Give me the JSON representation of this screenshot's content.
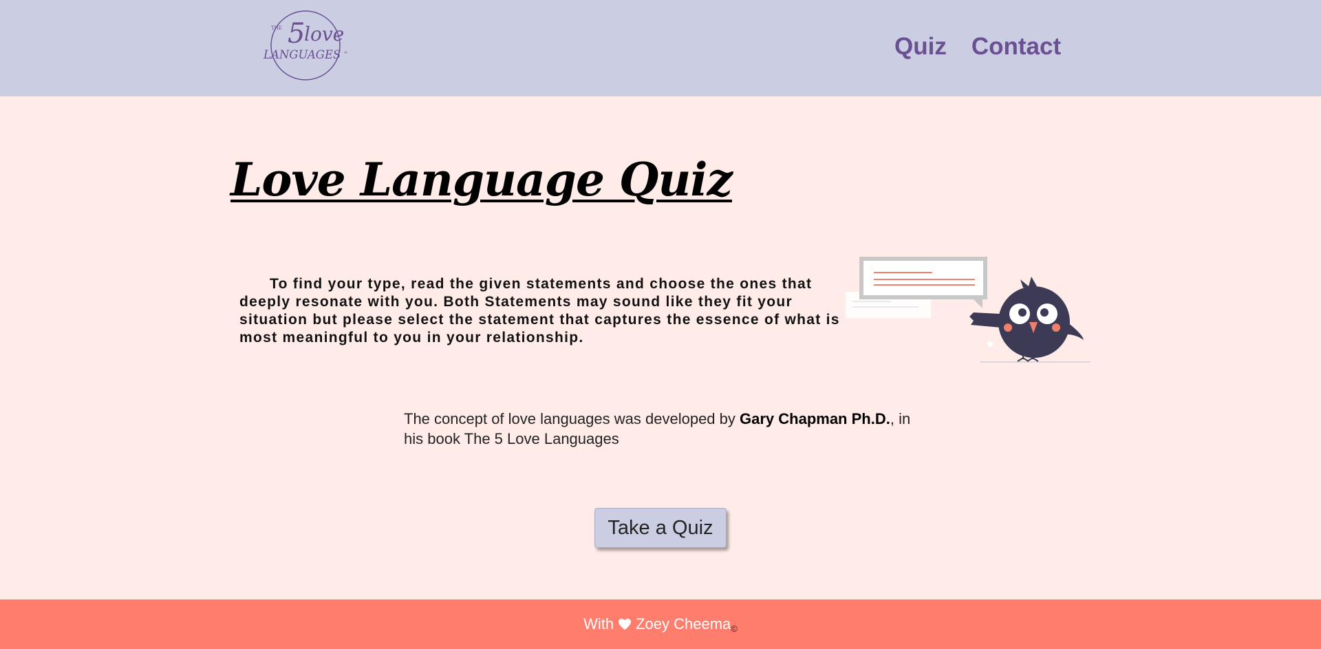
{
  "header": {
    "logo": {
      "the": "THE",
      "five": "5",
      "love": "love",
      "languages": "LANGUAGES",
      "reg": "®"
    },
    "nav": [
      {
        "label": "Quiz"
      },
      {
        "label": "Contact"
      }
    ]
  },
  "main": {
    "title": "Love Language Quiz",
    "intro": "To find your type, read the given statements and choose the ones that deeply resonate with you. Both Statements may sound like they fit your situation but please select the statement that captures the essence of what is most meaningful to you in your relationship.",
    "credit": {
      "prefix": "The concept of love languages was developed by ",
      "author": "Gary Chapman Ph.D.",
      "suffix": ", in his book The 5 Love Languages"
    },
    "cta_label": "Take a Quiz"
  },
  "footer": {
    "with": "With",
    "heart_icon": "heart-icon",
    "name": "Zoey Cheema",
    "copyright": "©"
  },
  "colors": {
    "header_bg": "#cbcee2",
    "page_bg": "#ffece9",
    "nav_text": "#6a4f92",
    "footer_bg": "#fe7d6d",
    "bird_body": "#3d3a55",
    "accent_line": "#f07f6c"
  }
}
